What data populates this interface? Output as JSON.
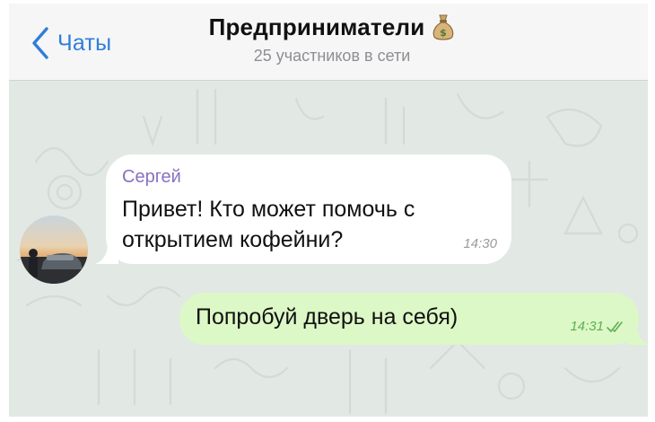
{
  "header": {
    "back_label": "Чаты",
    "title": "Предприниматели",
    "title_icon": "money-bag-icon",
    "subtitle": "25 участников в сети"
  },
  "messages": [
    {
      "direction": "incoming",
      "sender": "Сергей",
      "text": "Привет! Кто может помочь с открытием кофейни?",
      "time": "14:30"
    },
    {
      "direction": "outgoing",
      "text": "Попробуй дверь на себя)",
      "time": "14:31",
      "status_icon": "double-check-icon"
    }
  ],
  "colors": {
    "accent": "#2f7ed8",
    "sender_name": "#8a6fc2",
    "outgoing_bubble": "#dcf8c6",
    "chat_background": "#e2e8e4",
    "read_check": "#5fae55"
  }
}
